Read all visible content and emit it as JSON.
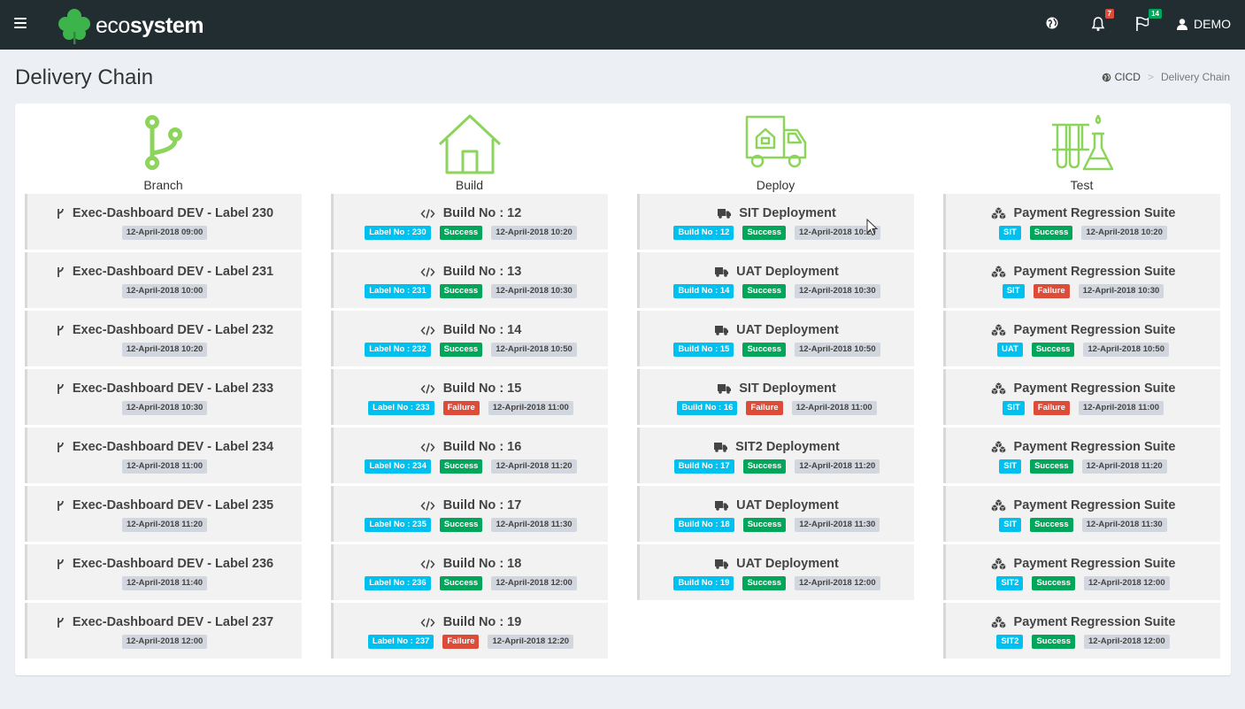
{
  "app": {
    "brand_light": "eco",
    "brand_bold": "system",
    "user": "DEMO",
    "notifications_count": "7",
    "flags_count": "14"
  },
  "page": {
    "title": "Delivery Chain",
    "breadcrumb": [
      "CICD",
      "Delivery Chain"
    ]
  },
  "colors": {
    "accent": "#8cd45c",
    "aqua": "#00c0ef",
    "success": "#00a65a",
    "failure": "#dd4b39",
    "topbar": "#222d32"
  },
  "columns": {
    "branch": {
      "title": "Branch",
      "icon": "git-branch-icon",
      "items": [
        {
          "title": "Exec-Dashboard DEV - Label 230",
          "date": "12-April-2018 09:00"
        },
        {
          "title": "Exec-Dashboard DEV - Label 231",
          "date": "12-April-2018 10:00"
        },
        {
          "title": "Exec-Dashboard DEV - Label 232",
          "date": "12-April-2018 10:20"
        },
        {
          "title": "Exec-Dashboard DEV - Label 233",
          "date": "12-April-2018 10:30"
        },
        {
          "title": "Exec-Dashboard DEV - Label 234",
          "date": "12-April-2018 11:00"
        },
        {
          "title": "Exec-Dashboard DEV - Label 235",
          "date": "12-April-2018 11:20"
        },
        {
          "title": "Exec-Dashboard DEV - Label 236",
          "date": "12-April-2018 11:40"
        },
        {
          "title": "Exec-Dashboard DEV - Label 237",
          "date": "12-April-2018 12:00"
        }
      ]
    },
    "build": {
      "title": "Build",
      "icon": "house-icon",
      "items": [
        {
          "title": "Build No : 12",
          "ref": "Label No : 230",
          "status": "Success",
          "date": "12-April-2018 10:20"
        },
        {
          "title": "Build No : 13",
          "ref": "Label No : 231",
          "status": "Success",
          "date": "12-April-2018 10:30"
        },
        {
          "title": "Build No : 14",
          "ref": "Label No : 232",
          "status": "Success",
          "date": "12-April-2018 10:50"
        },
        {
          "title": "Build No : 15",
          "ref": "Label No : 233",
          "status": "Failure",
          "date": "12-April-2018 11:00"
        },
        {
          "title": "Build No : 16",
          "ref": "Label No : 234",
          "status": "Success",
          "date": "12-April-2018 11:20"
        },
        {
          "title": "Build No : 17",
          "ref": "Label No : 235",
          "status": "Success",
          "date": "12-April-2018 11:30"
        },
        {
          "title": "Build No : 18",
          "ref": "Label No : 236",
          "status": "Success",
          "date": "12-April-2018 12:00"
        },
        {
          "title": "Build No : 19",
          "ref": "Label No : 237",
          "status": "Failure",
          "date": "12-April-2018 12:20"
        }
      ]
    },
    "deploy": {
      "title": "Deploy",
      "icon": "delivery-truck-icon",
      "items": [
        {
          "title": "SIT Deployment",
          "ref": "Build No : 12",
          "status": "Success",
          "date": "12-April-2018 10:20"
        },
        {
          "title": "UAT Deployment",
          "ref": "Build No : 14",
          "status": "Success",
          "date": "12-April-2018 10:30"
        },
        {
          "title": "UAT Deployment",
          "ref": "Build No : 15",
          "status": "Success",
          "date": "12-April-2018 10:50"
        },
        {
          "title": "SIT Deployment",
          "ref": "Build No : 16",
          "status": "Failure",
          "date": "12-April-2018 11:00"
        },
        {
          "title": "SIT2 Deployment",
          "ref": "Build No : 17",
          "status": "Success",
          "date": "12-April-2018 11:20"
        },
        {
          "title": "UAT Deployment",
          "ref": "Build No : 18",
          "status": "Success",
          "date": "12-April-2018 11:30"
        },
        {
          "title": "UAT Deployment",
          "ref": "Build No : 19",
          "status": "Success",
          "date": "12-April-2018 12:00"
        }
      ]
    },
    "test": {
      "title": "Test",
      "icon": "lab-flask-icon",
      "items": [
        {
          "title": "Payment Regression Suite",
          "ref": "SIT",
          "status": "Success",
          "date": "12-April-2018 10:20"
        },
        {
          "title": "Payment Regression Suite",
          "ref": "SIT",
          "status": "Failure",
          "date": "12-April-2018 10:30"
        },
        {
          "title": "Payment Regression Suite",
          "ref": "UAT",
          "status": "Success",
          "date": "12-April-2018 10:50"
        },
        {
          "title": "Payment Regression Suite",
          "ref": "SIT",
          "status": "Failure",
          "date": "12-April-2018 11:00"
        },
        {
          "title": "Payment Regression Suite",
          "ref": "SIT",
          "status": "Success",
          "date": "12-April-2018 11:20"
        },
        {
          "title": "Payment Regression Suite",
          "ref": "SIT",
          "status": "Success",
          "date": "12-April-2018 11:30"
        },
        {
          "title": "Payment Regression Suite",
          "ref": "SIT2",
          "status": "Success",
          "date": "12-April-2018 12:00"
        },
        {
          "title": "Payment Regression Suite",
          "ref": "SIT2",
          "status": "Success",
          "date": "12-April-2018 12:00"
        }
      ]
    }
  }
}
